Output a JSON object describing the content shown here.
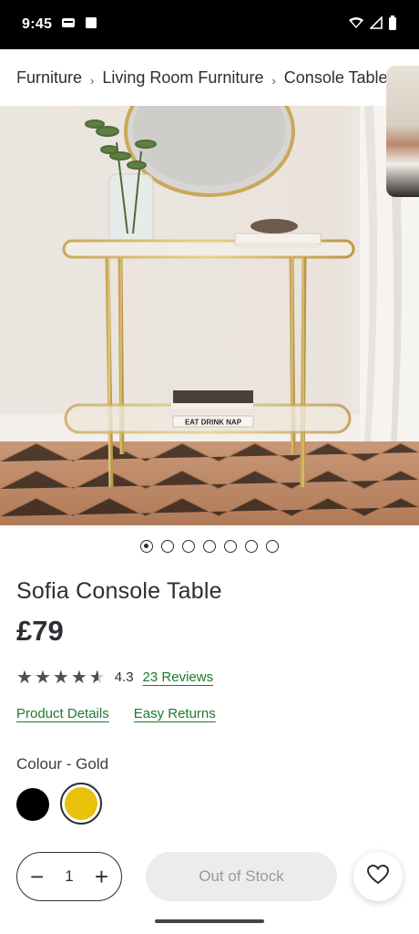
{
  "status_bar": {
    "time": "9:45",
    "icons": [
      "sim-icon",
      "square-notification-icon",
      "wifi-icon",
      "signal-icon",
      "battery-icon"
    ]
  },
  "breadcrumb": {
    "items": [
      "Furniture",
      "Living Room Furniture",
      "Console Tables"
    ],
    "separator": "›"
  },
  "product": {
    "title": "Sofia Console Table",
    "price": "£79",
    "gallery": {
      "image_count": 7,
      "active_index": 0,
      "book_spine_text": "EAT DRINK NAP"
    },
    "rating": {
      "value": "4.3",
      "value_numeric": 4.3,
      "max": 5,
      "reviews_label": "23 Reviews"
    },
    "links": {
      "details": "Product Details",
      "returns": "Easy Returns"
    },
    "colour": {
      "label": "Colour - Gold",
      "options": [
        {
          "name": "Black",
          "hex": "#000000",
          "selected": false
        },
        {
          "name": "Gold",
          "hex": "#e8c10a",
          "selected": true
        }
      ]
    }
  },
  "purchase": {
    "quantity": "1",
    "decrement_symbol": "−",
    "increment_symbol": "+",
    "stock_button_label": "Out of Stock",
    "wishlist_icon": "heart-icon"
  },
  "colors": {
    "link_green": "#1d7a2e",
    "text_dark": "#2b2f33",
    "gold": "#e8c10a"
  }
}
